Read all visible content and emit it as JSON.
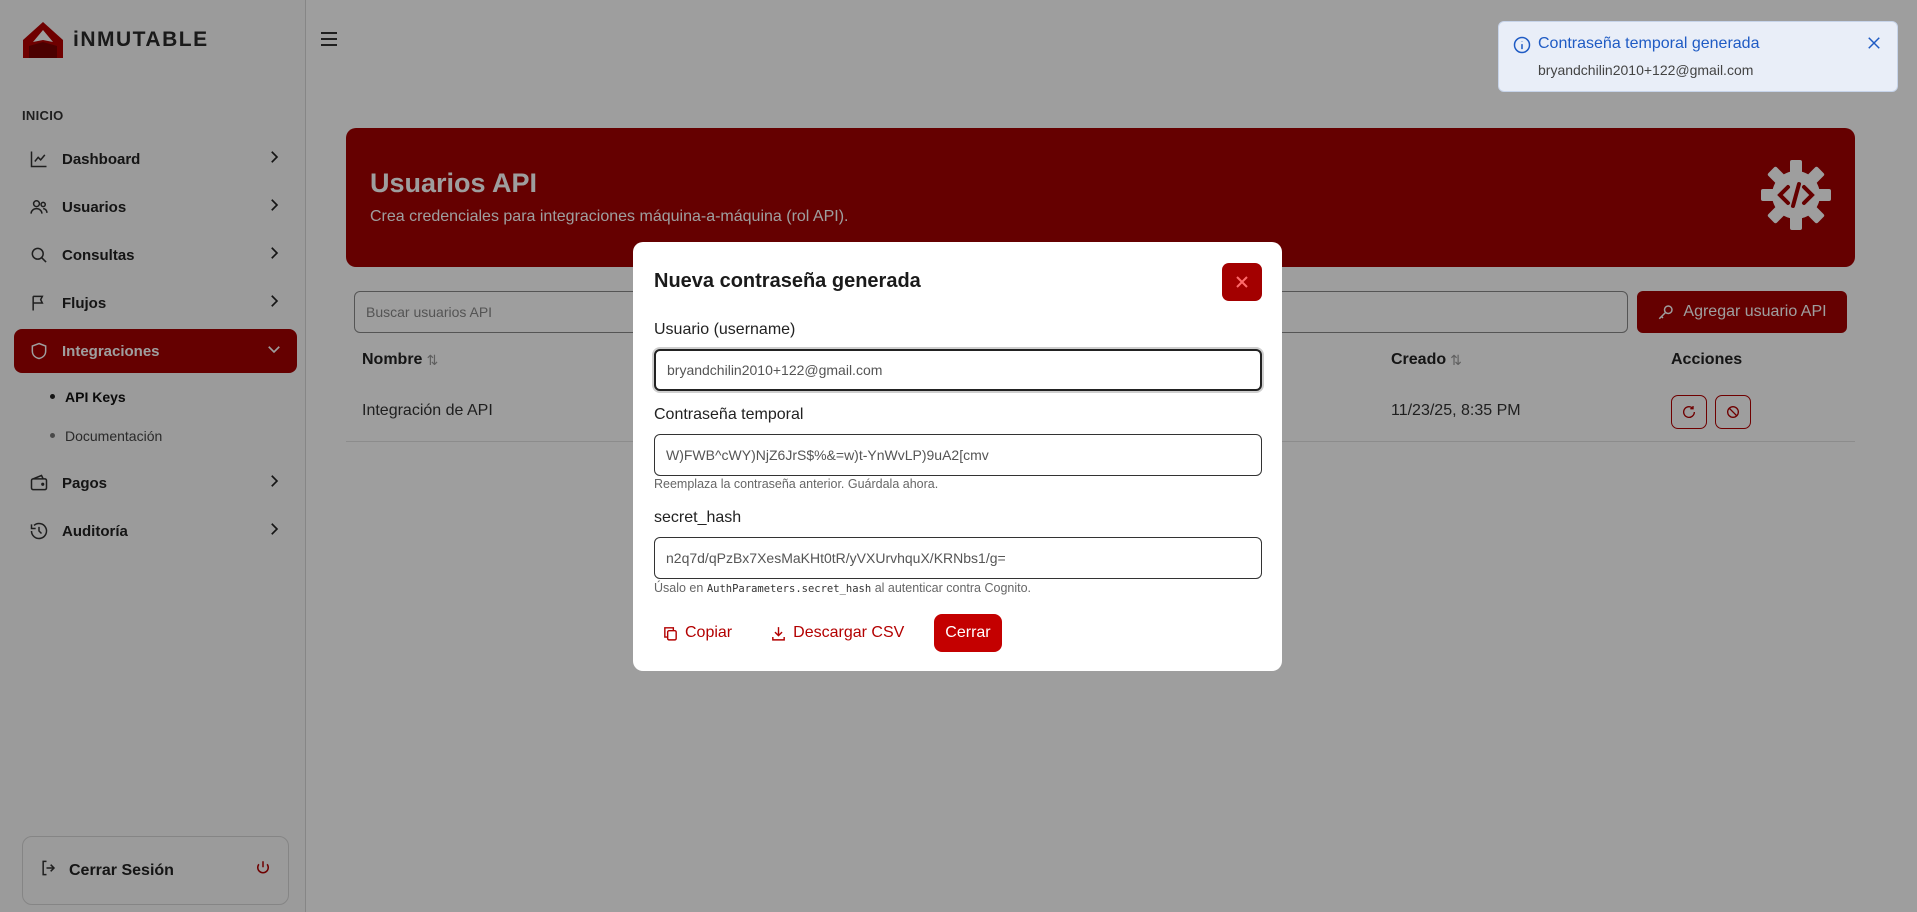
{
  "brand": {
    "name": "iNMUTABLE",
    "color": "#a30000"
  },
  "sidebar": {
    "section_label": "INICIO",
    "items": [
      {
        "label": "Dashboard",
        "icon": "chart-line-icon"
      },
      {
        "label": "Usuarios",
        "icon": "users-icon"
      },
      {
        "label": "Consultas",
        "icon": "search-icon"
      },
      {
        "label": "Flujos",
        "icon": "flag-icon"
      },
      {
        "label": "Integraciones",
        "icon": "shield-icon",
        "active": true
      },
      {
        "label": "Pagos",
        "icon": "wallet-icon"
      },
      {
        "label": "Auditoría",
        "icon": "history-icon"
      }
    ],
    "subitems": [
      {
        "label": "API Keys",
        "current": true
      },
      {
        "label": "Documentación"
      }
    ],
    "logout_label": "Cerrar Sesión"
  },
  "banner": {
    "title": "Usuarios API",
    "subtitle": "Crea credenciales para integraciones máquina-a-máquina (rol API)."
  },
  "search": {
    "placeholder": "Buscar usuarios API"
  },
  "add_button_label": "Agregar usuario API",
  "table": {
    "columns": [
      "Nombre",
      "Creado",
      "Acciones"
    ],
    "rows": [
      {
        "nombre": "Integración de API",
        "creado": "11/23/25, 8:35 PM"
      }
    ]
  },
  "toast": {
    "title": "Contraseña temporal generada",
    "message": "bryandchilin2010+122@gmail.com"
  },
  "modal": {
    "title": "Nueva contraseña generada",
    "username_label": "Usuario (username)",
    "username_value": "bryandchilin2010+122@gmail.com",
    "password_label": "Contraseña temporal",
    "password_value": "W)FWB^cWY)NjZ6JrS$%&=w)t-YnWvLP)9uA2[cmv",
    "password_hint": "Reemplaza la contraseña anterior. Guárdala ahora.",
    "hash_label": "secret_hash",
    "hash_value": "n2q7d/qPzBx7XesMaKHt0tR/yVXUrvhquX/KRNbs1/g=",
    "hash_hint_pre": "Úsalo en",
    "hash_hint_code": "AuthParameters.secret_hash",
    "hash_hint_post": "al autenticar contra Cognito.",
    "copy_label": "Copiar",
    "download_label": "Descargar CSV",
    "close_label": "Cerrar"
  },
  "colors": {
    "accent": "#a30000",
    "info": "#1f5bc4",
    "overlay": "rgba(0,0,0,0.38)"
  }
}
